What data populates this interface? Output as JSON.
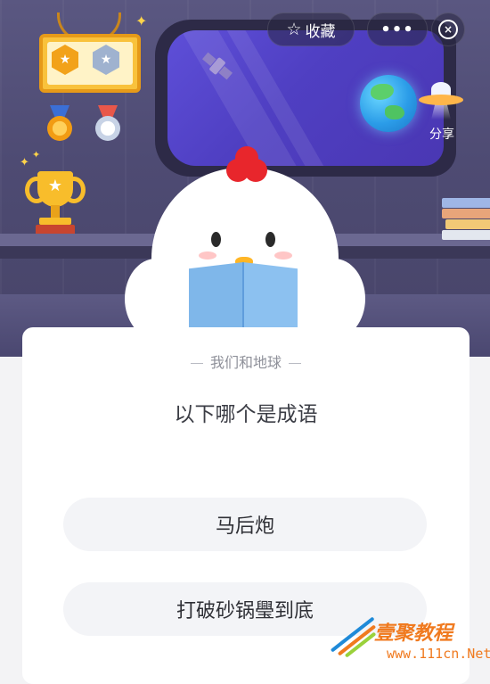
{
  "header": {
    "favorite_label": "收藏",
    "more_label": "•••",
    "share_label": "分享"
  },
  "quiz": {
    "category": "我们和地球",
    "question": "以下哪个是成语",
    "options": [
      "马后炮",
      "打破砂锅璺到底"
    ]
  },
  "watermark": {
    "title": "壹聚教程",
    "url": "www.111cn.Net"
  },
  "colors": {
    "scene_bg": "#4e4b73",
    "card_bg": "#ffffff",
    "option_bg": "#f3f4f7",
    "text_primary": "#3b3d45",
    "text_secondary": "#8e9099",
    "watermark": "#f07a1f"
  },
  "icons": {
    "favorite": "star-outline",
    "close": "close-circle",
    "share": "ufo"
  }
}
